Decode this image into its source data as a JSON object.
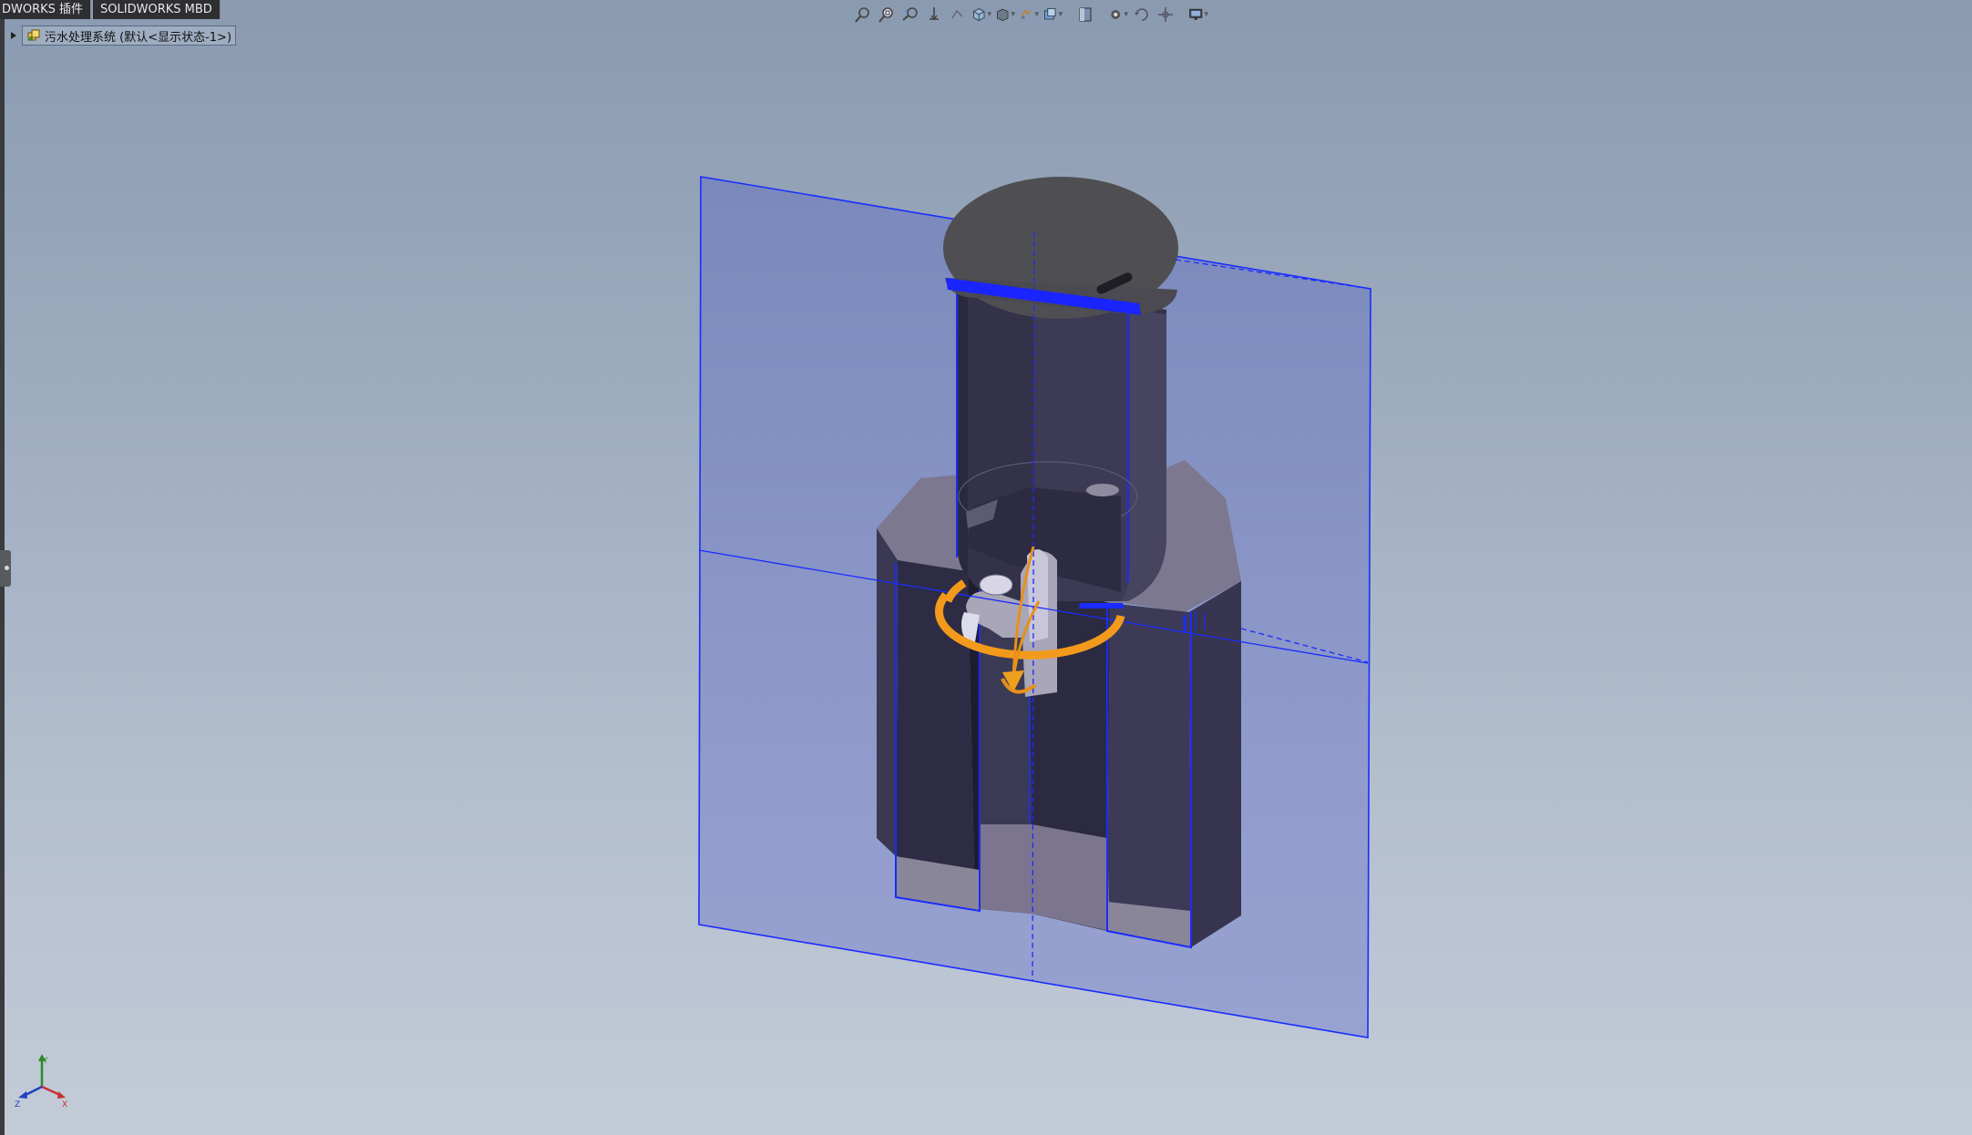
{
  "tabs": [
    "DWORKS 插件",
    "SOLIDWORKS MBD"
  ],
  "tree": {
    "root_label": "污水处理系统  (默认<显示状态-1>)"
  },
  "toolbar": {
    "icons": [
      "zoom-to-fit-icon",
      "zoom-to-area-icon",
      "previous-view-icon",
      "section-view-icon",
      "dynamic-annotation-icon",
      "view-orientation-icon",
      "display-style-icon",
      "hide-show-items-icon",
      "edit-appearance-icon",
      "apply-scene-icon",
      "view-settings-icon",
      "rotate-icon",
      "pan-icon",
      "display-pane-icon"
    ]
  },
  "triad": {
    "x_label": "X",
    "y_label": "Y",
    "z_label": "Z"
  },
  "colors": {
    "plane": "#4a58c8",
    "plane_edge": "#1a2cff",
    "model_dark": "#2f2e46",
    "model_face": "#3d3b58",
    "model_top": "#7e7a94",
    "lid": "#4f4f53",
    "rotate_handle": "#f39a1c"
  }
}
